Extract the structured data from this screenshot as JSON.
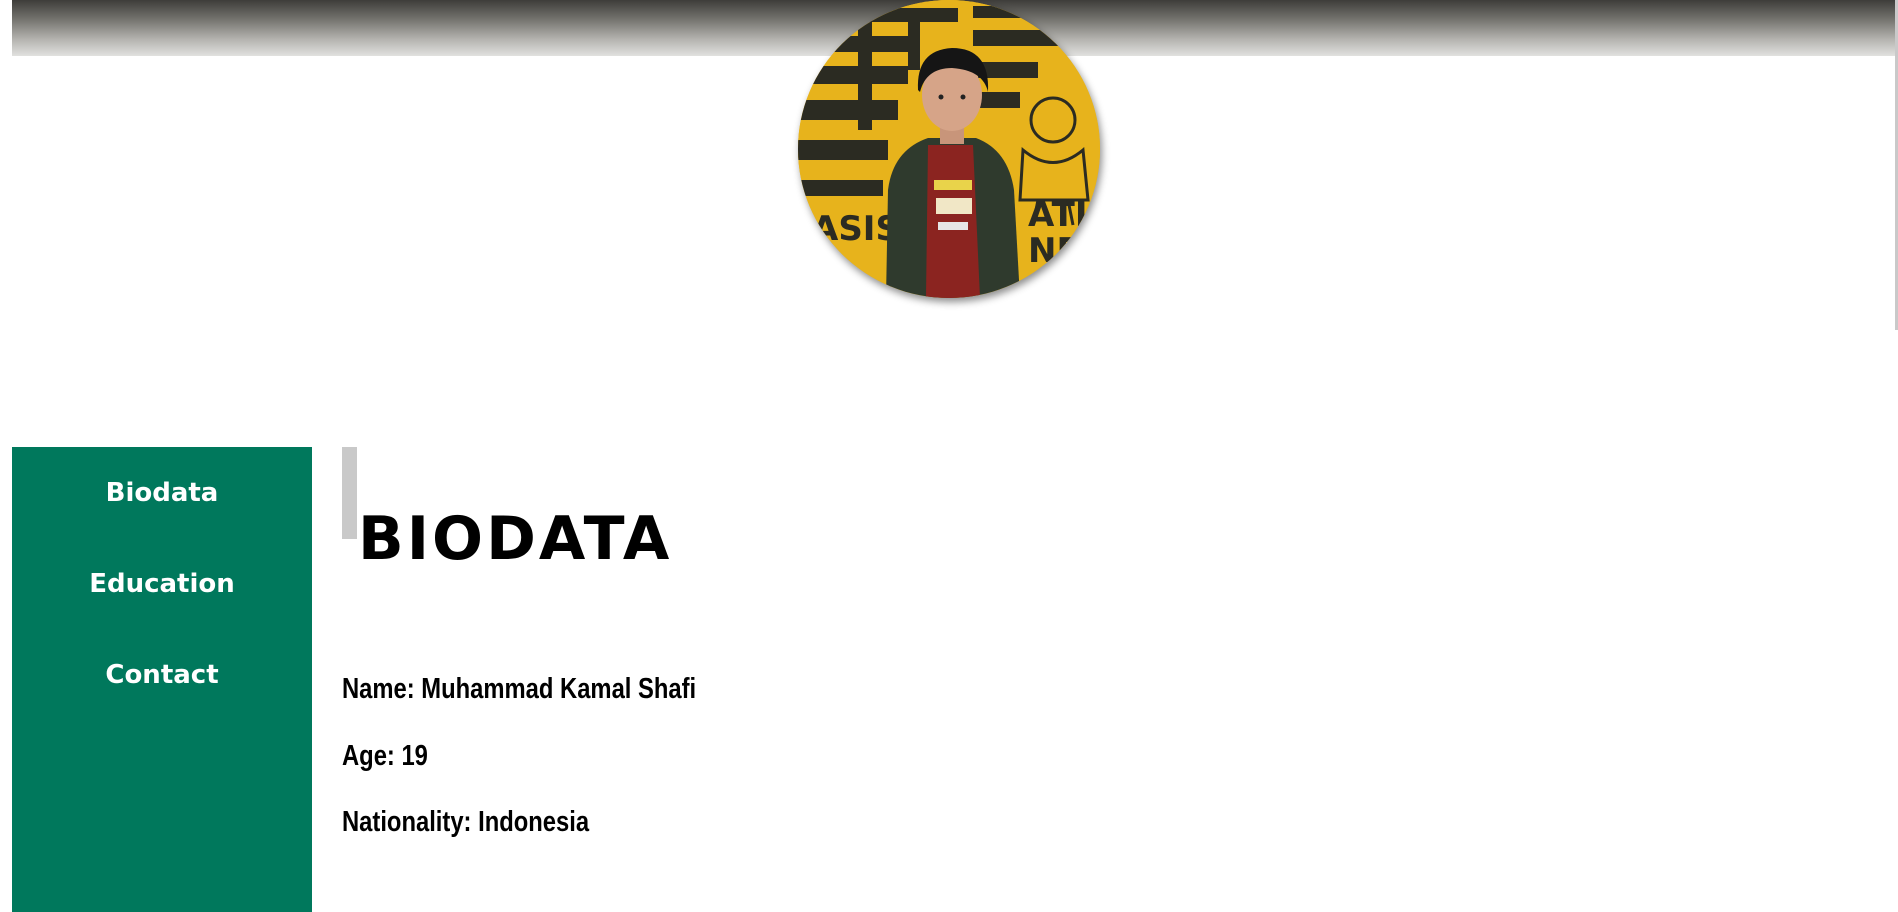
{
  "avatar": {
    "alt": "Profile photo",
    "colors": {
      "banner": "#e7b31c",
      "stripes": "#2b2b22",
      "jacket": "#2f3a2d",
      "shirt": "#8b2420"
    }
  },
  "sidebar": {
    "background": "#00785c",
    "items": [
      {
        "label": "Biodata"
      },
      {
        "label": "Education"
      },
      {
        "label": "Contact"
      }
    ]
  },
  "main": {
    "title": "BIODATA",
    "name_line": "Name: Muhammad Kamal Shafi",
    "age_line": "Age: 19",
    "nationality_line": "Nationality: Indonesia"
  }
}
